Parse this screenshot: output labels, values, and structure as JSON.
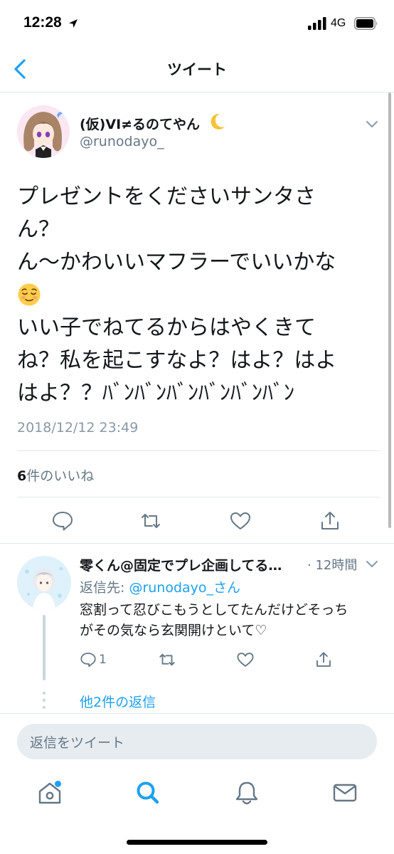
{
  "status_bar": {
    "time": "12:28",
    "network": "4G"
  },
  "nav": {
    "title": "ツイート"
  },
  "tweet": {
    "author_name": "(仮)VI≠るのてやん",
    "author_handle": "@runodayo_",
    "text_lines": [
      "プレゼントをくださいサンタさ",
      "ん？",
      "ん〜かわいいマフラーでいいかな",
      "",
      "いい子でねてるからはやくきて",
      "ね？私を起こすなよ？はよ？はよ",
      "はよ？？ﾊﾞﾝﾊﾞﾝﾊﾞﾝﾊﾞﾝﾊﾞﾝﾊﾞﾝ"
    ],
    "timestamp": "2018/12/12 23:49",
    "likes_count": "6",
    "likes_label": "件のいいね"
  },
  "reply": {
    "author_name": "零くん@固定でプレ企画してる…",
    "time": "· 12時間",
    "reply_to_label": "返信先: ",
    "reply_to_mention": "@runodayo_さん",
    "text_lines": [
      "窓割って忍びこもうとしてたんだけどそっち",
      "がその気なら玄関開けといて♡"
    ],
    "reply_count": "1",
    "more_replies": "他2件の返信"
  },
  "compose": {
    "placeholder": "返信をツイート"
  },
  "colors": {
    "accent": "#1da1f2",
    "secondary_text": "#657786",
    "divider": "#e1e8ed",
    "notification_dot": "#1da1f2"
  },
  "icons": {
    "status": [
      "location-arrow-icon",
      "signal-bars-icon",
      "battery-icon"
    ],
    "actions": [
      "reply-icon",
      "retweet-icon",
      "like-icon",
      "share-icon"
    ],
    "tabs": [
      "home-icon",
      "search-icon",
      "notifications-icon",
      "messages-icon"
    ]
  }
}
